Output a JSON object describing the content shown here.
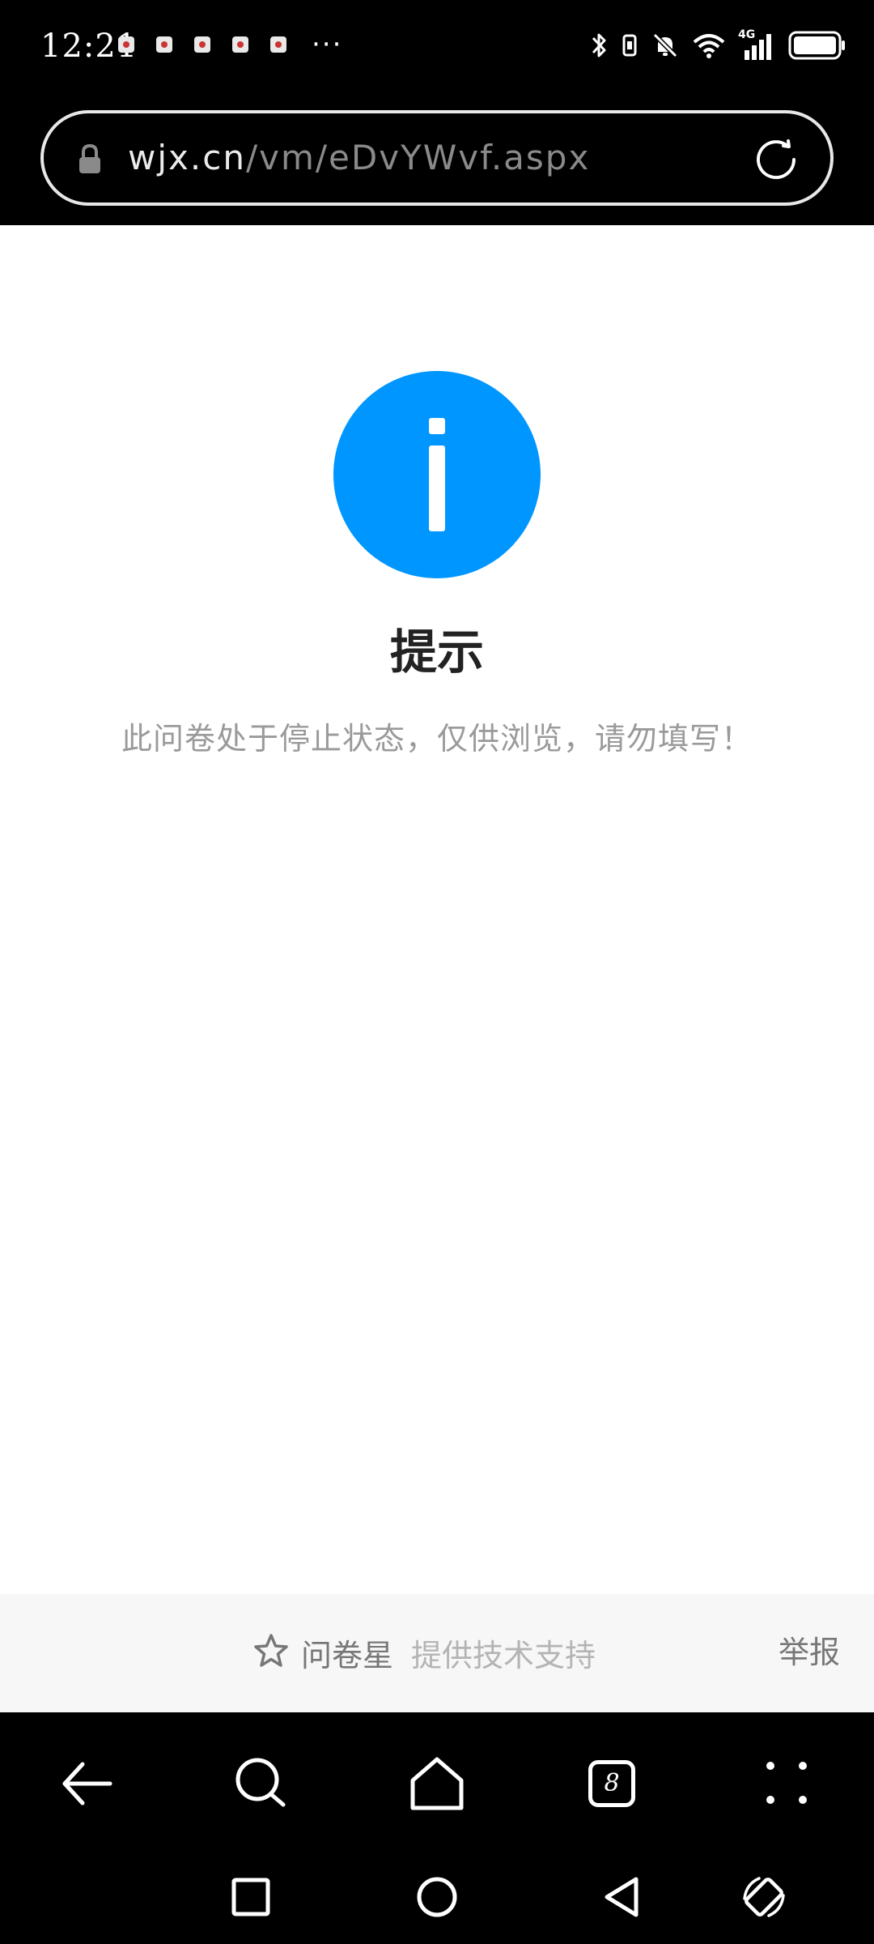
{
  "status_bar": {
    "time": "12:21",
    "more_indicator": "···",
    "network_label": "4G"
  },
  "browser": {
    "url_host": "wjx.cn",
    "url_path": "/vm/eDvYWvf.aspx",
    "tab_count": "8"
  },
  "notice": {
    "title": "提示",
    "message": "此问卷处于停止状态，仅供浏览，请勿填写！"
  },
  "footer": {
    "brand_name": "问卷星",
    "support_text": "提供技术支持",
    "report_label": "举报"
  },
  "colors": {
    "accent": "#0096ff",
    "chrome_background": "#000000",
    "footer_background": "#f7f7f7"
  },
  "icons": {
    "status": [
      "bluetooth-icon",
      "vibrate-icon",
      "mute-icon",
      "wifi-icon",
      "signal-icon",
      "battery-icon"
    ],
    "toolbar": [
      "back-arrow-icon",
      "search-icon",
      "home-icon",
      "tabs-icon",
      "menu-dots-icon"
    ],
    "system_nav": [
      "recents-square-icon",
      "home-circle-icon",
      "back-triangle-icon",
      "rotate-icon"
    ]
  }
}
